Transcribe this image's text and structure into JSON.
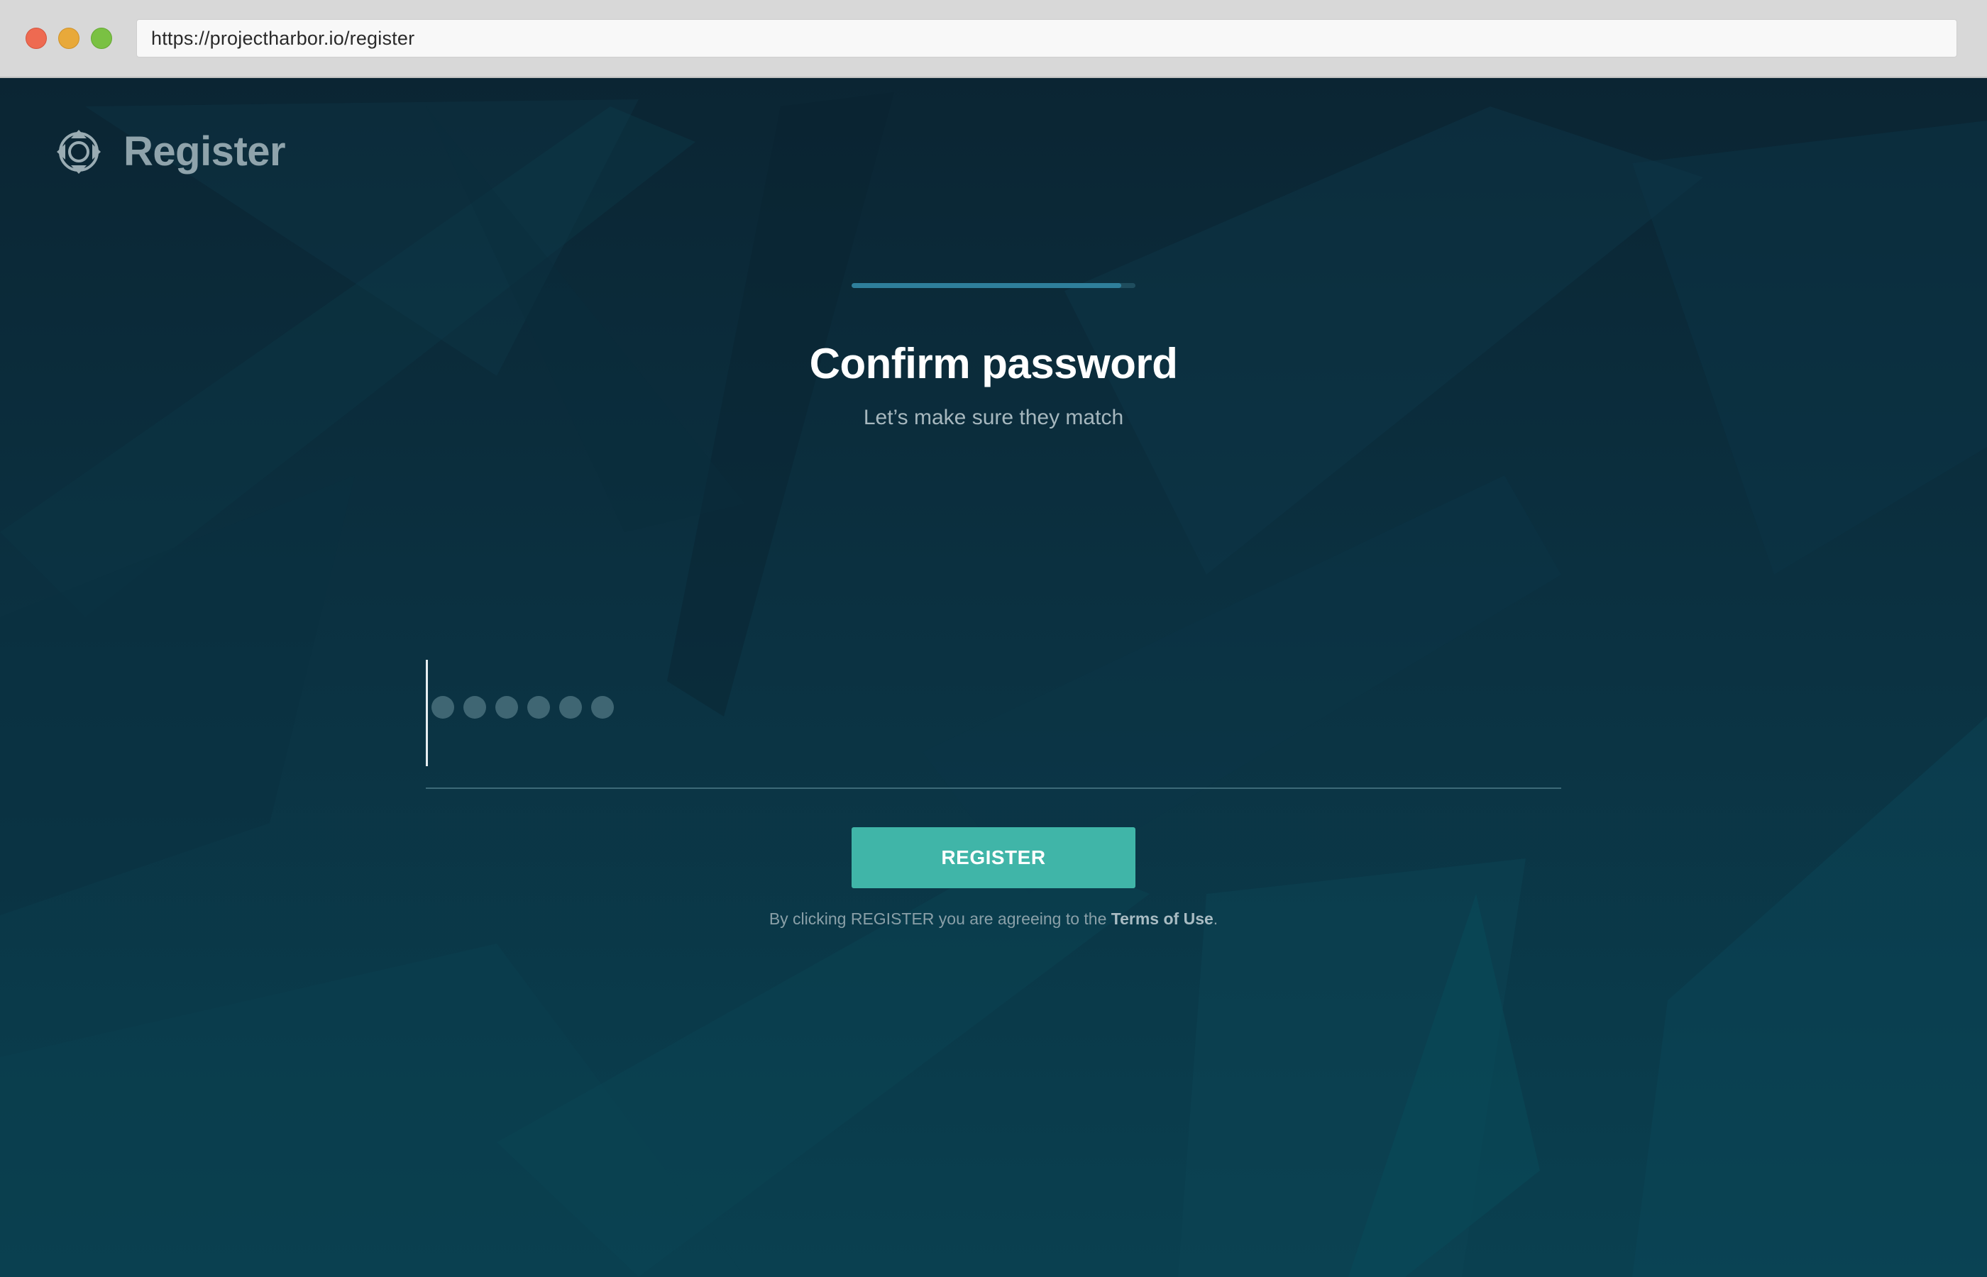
{
  "browser": {
    "url": "https://projectharbor.io/register"
  },
  "brand": {
    "logo_icon": "lifebuoy-icon",
    "title": "Register"
  },
  "progress": {
    "fraction": 0.95,
    "fill_color": "#2f7f9b",
    "track_color": "#1f4d5e"
  },
  "form": {
    "heading": "Confirm password",
    "subheading": "Let’s make sure they match",
    "password_dot_count": 6,
    "register_label": "REGISTER"
  },
  "terms": {
    "prefix": "By clicking REGISTER you are agreeing to the ",
    "link_label": "Terms of Use",
    "suffix": "."
  },
  "colors": {
    "accent": "#40b5a8",
    "background": "#0b3141",
    "heading": "#ffffff"
  }
}
